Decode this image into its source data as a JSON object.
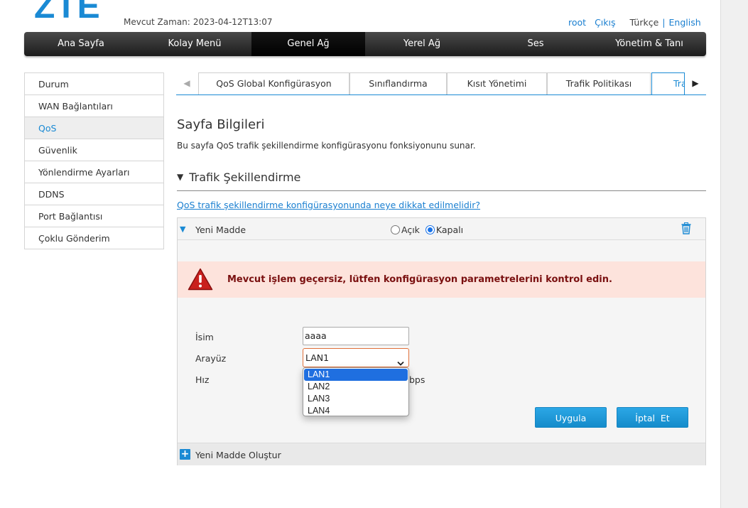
{
  "header": {
    "logo": "ZTE",
    "time_label": "Mevcut Zaman:",
    "time_value": "2023-04-12T13:07",
    "user": "root",
    "logout": "Çıkış",
    "lang_current": "Türkçe",
    "lang_separator": "|",
    "lang_other": "English"
  },
  "main_nav": {
    "items": [
      {
        "label": "Ana Sayfa"
      },
      {
        "label": "Kolay Menü"
      },
      {
        "label": "Genel Ağ"
      },
      {
        "label": "Yerel Ağ"
      },
      {
        "label": "Ses"
      },
      {
        "label": "Yönetim & Tanı"
      }
    ],
    "active_index": 2
  },
  "sidebar": {
    "items": [
      {
        "label": "Durum"
      },
      {
        "label": "WAN Bağlantıları"
      },
      {
        "label": "QoS"
      },
      {
        "label": "Güvenlik"
      },
      {
        "label": "Yönlendirme Ayarları"
      },
      {
        "label": "DDNS"
      },
      {
        "label": "Port Bağlantısı"
      },
      {
        "label": "Çoklu Gönderim"
      }
    ],
    "active_index": 2
  },
  "tabs": {
    "items": [
      {
        "label": "QoS Global Konfigürasyon"
      },
      {
        "label": "Sınıflandırma"
      },
      {
        "label": "Kısıt Yönetimi"
      },
      {
        "label": "Trafik Politikası"
      },
      {
        "label": "Tra"
      }
    ],
    "active_index": 4,
    "left_arrow": "◀",
    "right_arrow": "▶"
  },
  "page": {
    "title": "Sayfa Bilgileri",
    "description": "Bu sayfa QoS trafik şekillendirme konfigürasyonu fonksiyonunu sunar.",
    "section_title": "Trafik Şekillendirme",
    "section_arrow": "▼",
    "help_link": "QoS trafik şekillendirme konfigürasyonunda neye dikkat edilmelidir?"
  },
  "panel": {
    "expand_glyph": "▼",
    "item_title": "Yeni Madde",
    "radio_on": "Açık",
    "radio_off": "Kapalı",
    "selected_radio": "Kapalı",
    "alert_text": "Mevcut işlem geçersiz, lütfen konfigürasyon parametrelerini kontrol edin.",
    "labels": {
      "name": "İsim",
      "interface": "Arayüz",
      "speed": "Hız"
    },
    "name_value": "aaaa",
    "interface_value": "LAN1",
    "interface_options": [
      "LAN1",
      "LAN2",
      "LAN3",
      "LAN4"
    ],
    "speed_unit_visible": "bps",
    "apply_button": "Uygula",
    "cancel_button": "İptal  Et",
    "create_new": "Yeni Madde Oluştur",
    "plus_glyph": "+"
  },
  "colors": {
    "brand_blue": "#1a8ad4",
    "alert_bg": "#fde3dc",
    "alert_text": "#7a1010",
    "button_blue": "#1f9ad9",
    "nav_dark": "#1c1c1c"
  },
  "icons": {
    "trash": "trash-icon",
    "warning": "warning-icon",
    "plus": "plus-icon",
    "expand": "triangle-down-icon"
  }
}
